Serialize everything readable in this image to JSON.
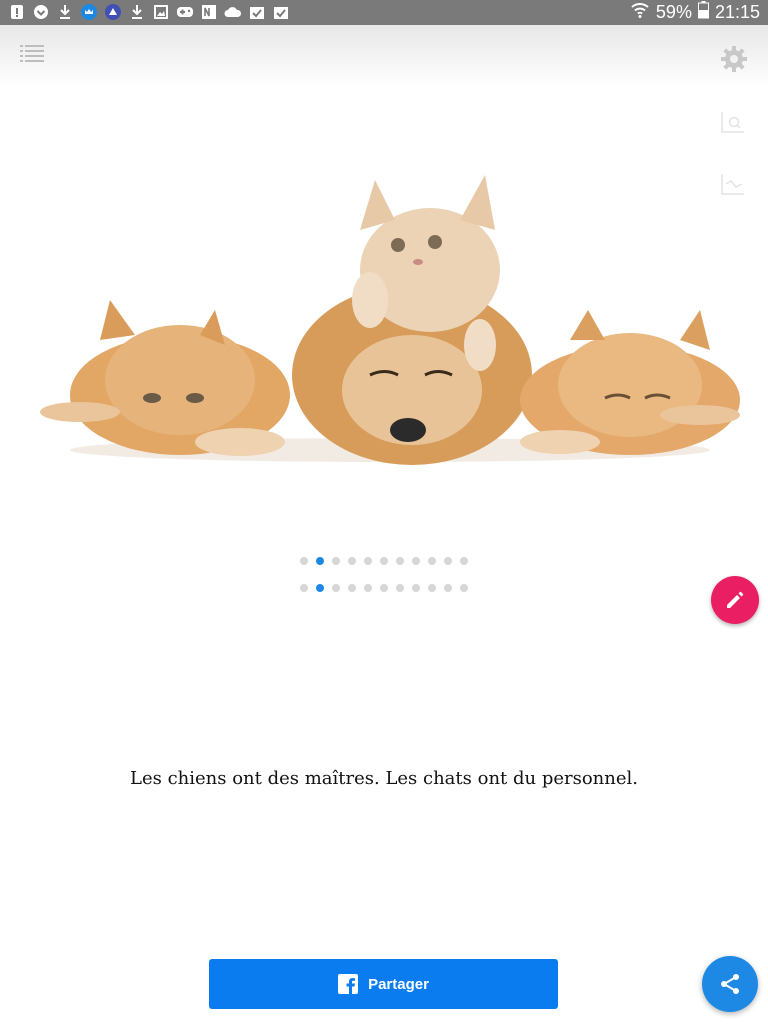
{
  "status_bar": {
    "battery": "59%",
    "time": "21:15",
    "notification_icons": [
      "alert-icon",
      "pocket-icon",
      "download-icon",
      "crown-app-icon",
      "sail-app-icon",
      "download-icon",
      "image-icon",
      "gamepad-icon",
      "onenote-icon",
      "cloud-icon",
      "checkbox-bag-icon",
      "checkbox-bag-icon"
    ]
  },
  "toolbar": {
    "menu_icon": "list-menu-icon",
    "settings_icon": "gear-icon"
  },
  "side_icons": [
    "search-magnifier-icon",
    "chart-icon"
  ],
  "pager": {
    "rows": 2,
    "dots_per_row": 11,
    "active_index": 1,
    "active_color": "#1e88e5",
    "inactive_color": "#d6d6d6"
  },
  "quote": {
    "text": "Les chiens ont des maîtres. Les chats ont du personnel."
  },
  "share_button": {
    "label": "Partager",
    "icon": "facebook-icon",
    "color": "#0a7cf0"
  },
  "fab": {
    "edit_icon": "pencil-icon",
    "edit_color": "#e91e63",
    "share_icon": "share-icon",
    "share_color": "#1e88e5"
  }
}
